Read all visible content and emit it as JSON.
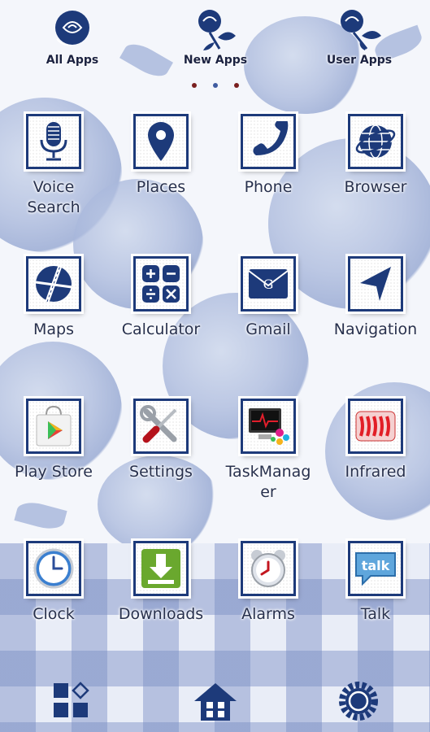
{
  "tabs": [
    {
      "label": "All Apps",
      "icon": "rose-icon"
    },
    {
      "label": "New Apps",
      "icon": "rose-icon"
    },
    {
      "label": "User Apps",
      "icon": "rose-icon"
    }
  ],
  "page_indicator": {
    "count": 3,
    "active": 2
  },
  "apps": [
    {
      "label": "Voice\nSearch",
      "icon": "microphone-icon"
    },
    {
      "label": "Places",
      "icon": "map-pin-icon"
    },
    {
      "label": "Phone",
      "icon": "phone-handset-icon"
    },
    {
      "label": "Browser",
      "icon": "globe-icon"
    },
    {
      "label": "Maps",
      "icon": "map-icon"
    },
    {
      "label": "Calculator",
      "icon": "calculator-icon"
    },
    {
      "label": "Gmail",
      "icon": "envelope-icon"
    },
    {
      "label": "Navigation",
      "icon": "navigation-arrow-icon"
    },
    {
      "label": "Play Store",
      "icon": "shopping-bag-icon"
    },
    {
      "label": "Settings",
      "icon": "tools-icon"
    },
    {
      "label": "TaskManag\ner",
      "icon": "monitor-icon"
    },
    {
      "label": "Infrared",
      "icon": "infrared-icon"
    },
    {
      "label": "Clock",
      "icon": "clock-icon"
    },
    {
      "label": "Downloads",
      "icon": "download-icon"
    },
    {
      "label": "Alarms",
      "icon": "alarm-clock-icon"
    },
    {
      "label": "Talk",
      "icon": "talk-bubble-icon"
    }
  ],
  "dock": [
    {
      "icon": "app-drawer-icon"
    },
    {
      "icon": "home-icon"
    },
    {
      "icon": "settings-gear-icon"
    }
  ],
  "colors": {
    "accent": "#1d3a7a",
    "text": "#27304d",
    "dot": "#7a1f1f"
  }
}
